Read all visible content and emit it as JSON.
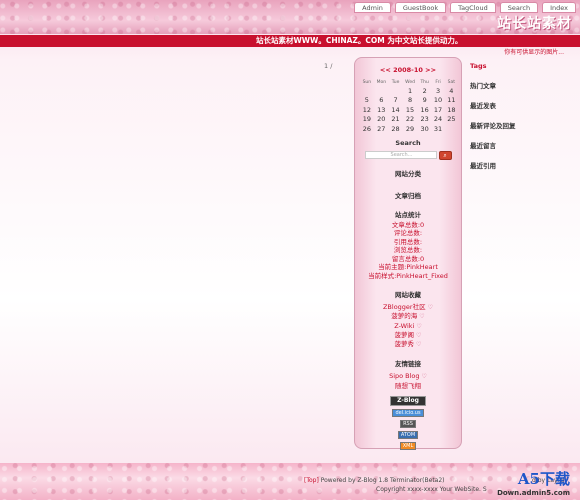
{
  "nav": [
    "Admin",
    "GuestBook",
    "TagCloud",
    "Search",
    "Index"
  ],
  "logo": "站长站素材",
  "slogan": "站长站素材WWW。CHINAZ。COM 为中文站长提供动力。",
  "subnote": "你有可供显示的图片...",
  "pager": "1 /",
  "calendar": {
    "title": "<< 2008-10 >>",
    "days": [
      "Sun",
      "Mon",
      "Tue",
      "Wed",
      "Thu",
      "Fri",
      "Sat"
    ],
    "weeks": [
      [
        "",
        "",
        "",
        "1",
        "2",
        "3",
        "4"
      ],
      [
        "5",
        "6",
        "7",
        "8",
        "9",
        "10",
        "11"
      ],
      [
        "12",
        "13",
        "14",
        "15",
        "16",
        "17",
        "18"
      ],
      [
        "19",
        "20",
        "21",
        "22",
        "23",
        "24",
        "25"
      ],
      [
        "26",
        "27",
        "28",
        "29",
        "30",
        "31",
        ""
      ]
    ]
  },
  "search": {
    "title": "Search",
    "placeholder": "Search..."
  },
  "sections": {
    "category": "网站分类",
    "archive": "文章归档",
    "stats": "站点统计"
  },
  "stats": [
    "文章总数:0",
    "评论总数:",
    "引用总数:",
    "浏览总数:",
    "留言总数:0",
    "当前主题:PinkHeart",
    "当前样式:PinkHeart_Fixed"
  ],
  "favorites": {
    "title": "网站收藏",
    "items": [
      "ZBlogger社区",
      "菠萝的海",
      "Z-Wiki",
      "菠萝阁",
      "菠萝秀"
    ]
  },
  "friends": {
    "title": "友情链接",
    "items": [
      "Sipo Blog",
      "随想飞翔"
    ]
  },
  "badges": [
    "Z-Blog",
    "del.icio.us",
    "RSS",
    "ATOM",
    "XML"
  ],
  "right_col": [
    {
      "label": "Tags",
      "red": true
    },
    {
      "label": "热门文章",
      "red": false
    },
    {
      "label": "最近发表",
      "red": false
    },
    {
      "label": "最新评论及回复",
      "red": false
    },
    {
      "label": "最近留言",
      "red": false
    },
    {
      "label": "最近引用",
      "red": false
    }
  ],
  "footer": {
    "top": "[Top]",
    "powered": "Powered by Z-Blog 1.8 Terminator(Beta2)",
    "designed": "d by Laylai",
    "copyright": "Copyright xxxx-xxxx Your WebSite. S"
  },
  "watermark": {
    "main": "A5下载",
    "sub": "Down.admin5.com"
  }
}
